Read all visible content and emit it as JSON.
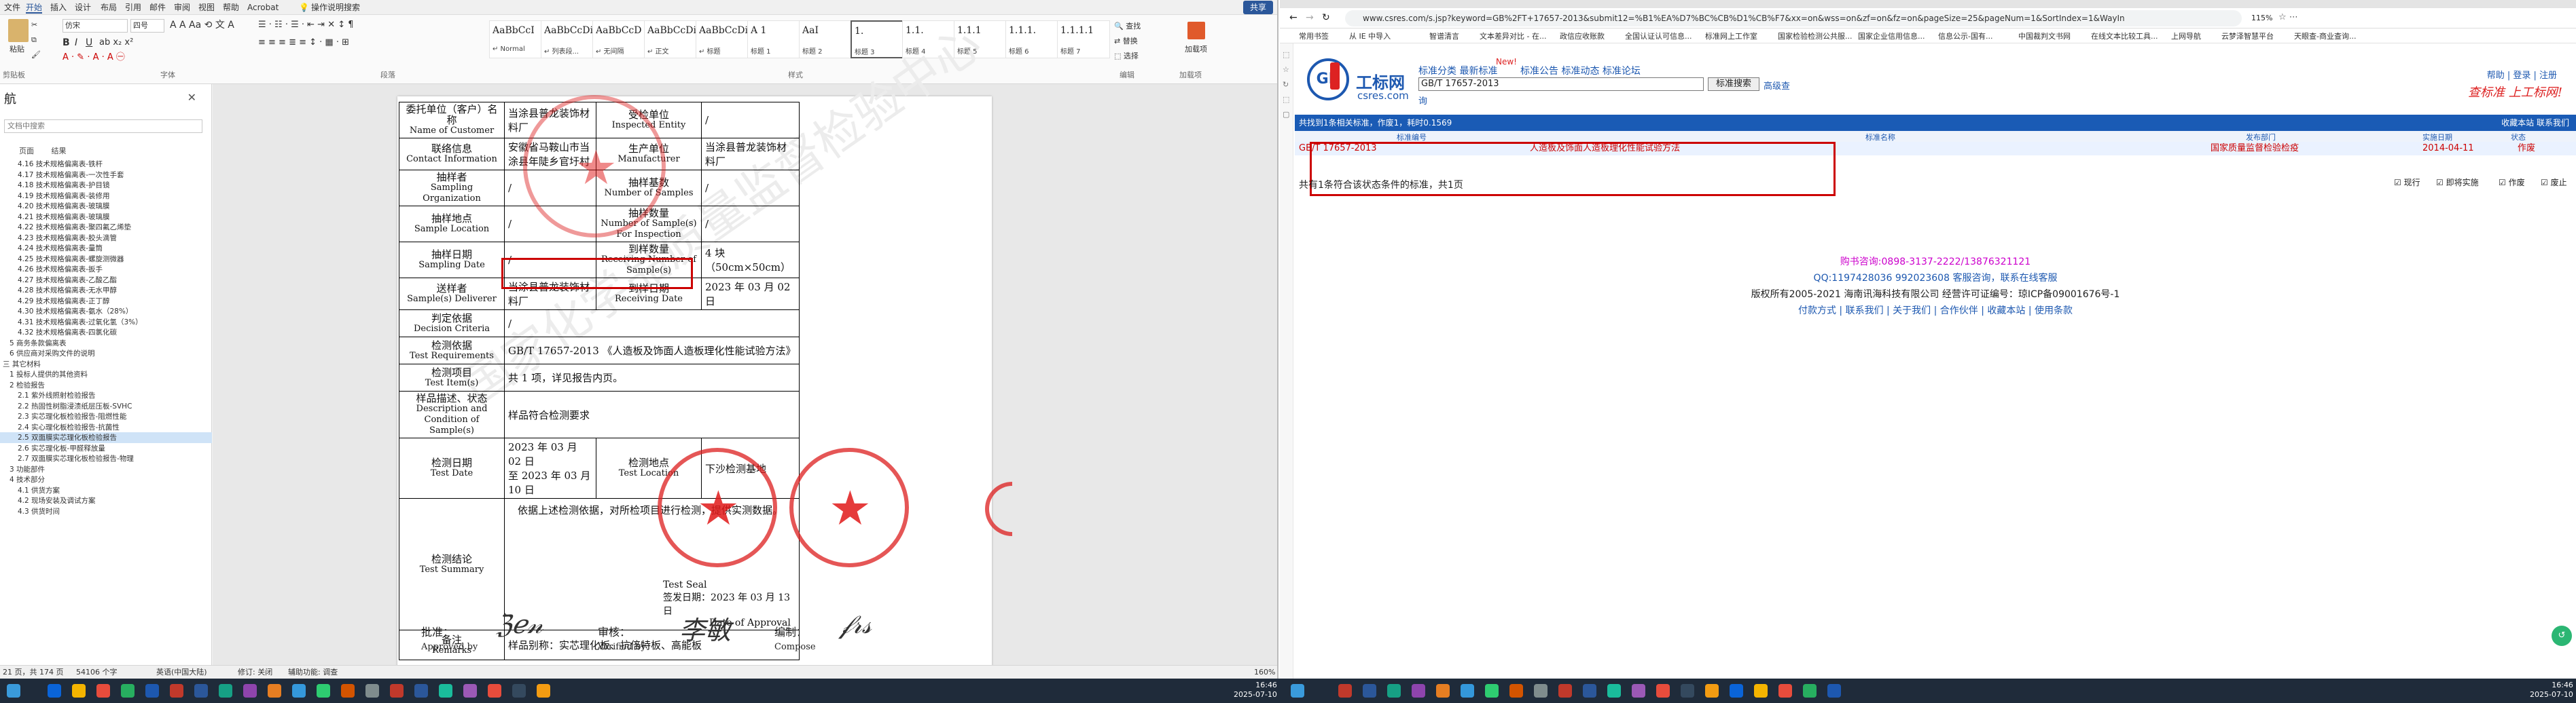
{
  "word": {
    "tabs": [
      "文件",
      "开始",
      "插入",
      "设计",
      "布局",
      "引用",
      "邮件",
      "审阅",
      "视图",
      "帮助",
      "Acrobat",
      "操作说明搜索"
    ],
    "active_tab": "开始",
    "share": "共享",
    "font_name": "仿宋",
    "font_size": "四号",
    "group_labels": [
      "剪贴板",
      "字体",
      "段落",
      "样式",
      "编辑",
      "加载项"
    ],
    "paste_label": "粘贴",
    "styles": [
      {
        "preview": "AaBbCcI",
        "name": "↵ Normal"
      },
      {
        "preview": "AaBbCcDi",
        "name": "↵ 列表段..."
      },
      {
        "preview": "AaBbCcD",
        "name": "↵ 无间隔"
      },
      {
        "preview": "AaBbCcDi",
        "name": "↵ 正文"
      },
      {
        "preview": "AaBbCcDi",
        "name": "↵ 标题"
      },
      {
        "preview": "A 1",
        "name": "标题 1"
      },
      {
        "preview": "AaI",
        "name": "标题 2"
      },
      {
        "preview": "1.",
        "name": "标题 3"
      },
      {
        "preview": "1.1.",
        "name": "标题 4"
      },
      {
        "preview": "1.1.1",
        "name": "标题 5"
      },
      {
        "preview": "1.1.1.",
        "name": "标题 6"
      },
      {
        "preview": "1.1.1.1",
        "name": "标题 7"
      }
    ],
    "edit": {
      "find": "查找",
      "replace": "替换",
      "select": "选择"
    },
    "addin": "加载项",
    "nav": {
      "title": "航",
      "search_placeholder": "文档中搜索",
      "tabs": [
        "页面",
        "结果"
      ],
      "items": [
        {
          "t": "4.16 技术规格偏离表-铁杆",
          "sel": false
        },
        {
          "t": "4.17 技术规格偏离表-一次性手套",
          "sel": false
        },
        {
          "t": "4.18 技术规格偏离表-护目镜",
          "sel": false
        },
        {
          "t": "4.19 技术规格偏离表-装修用",
          "sel": false
        },
        {
          "t": "4.20 技术规格偏离表-玻璃膜",
          "sel": false
        },
        {
          "t": "4.21 技术规格偏离表-玻璃膜",
          "sel": false
        },
        {
          "t": "4.22 技术规格偏离表-聚四氟乙烯垫",
          "sel": false
        },
        {
          "t": "4.23 技术规格偏离表-胶头滴管",
          "sel": false
        },
        {
          "t": "4.24 技术规格偏离表-量筒",
          "sel": false
        },
        {
          "t": "4.25 技术规格偏离表-螺旋测微器",
          "sel": false
        },
        {
          "t": "4.26 技术规格偏离表-扳手",
          "sel": false
        },
        {
          "t": "4.27 技术规格偏离表-乙酸乙酯",
          "sel": false
        },
        {
          "t": "4.28 技术规格偏离表-无水甲醇",
          "sel": false
        },
        {
          "t": "4.29 技术规格偏离表-正丁醇",
          "sel": false
        },
        {
          "t": "4.30 技术规格偏离表-氨水（28%）",
          "sel": false
        },
        {
          "t": "4.31 技术规格偏离表-过氧化氢（3%）",
          "sel": false
        },
        {
          "t": "4.32 技术规格偏离表-四氯化碳",
          "sel": false
        },
        {
          "t": "5 商务条款偏离表",
          "sel": false
        },
        {
          "t": "6 供应商对采购文件的说明",
          "sel": false
        },
        {
          "t": "三 其它材料",
          "sel": false
        },
        {
          "t": "1 投标人提供的其他资料",
          "sel": false
        },
        {
          "t": "2 检验报告",
          "sel": false
        },
        {
          "t": "2.1 紫外线照射检验报告",
          "sel": false
        },
        {
          "t": "2.2 热固性树脂浸渍纸层压板-SVHC",
          "sel": false
        },
        {
          "t": "2.3 实芯理化板检验报告-阻燃性能",
          "sel": false
        },
        {
          "t": "2.4 实心理化板检验报告-抗菌性",
          "sel": false
        },
        {
          "t": "2.5 双面膜实芯理化板检验报告",
          "sel": true
        },
        {
          "t": "2.6 实芯理化板-甲醛释放量",
          "sel": false
        },
        {
          "t": "2.7 双面膜实芯理化板检验报告-物理",
          "sel": false
        },
        {
          "t": "3 功能部件",
          "sel": false
        },
        {
          "t": "4 技术部分",
          "sel": false
        },
        {
          "t": "4.1 供货方案",
          "sel": false
        },
        {
          "t": "4.2 现场安装及调试方案",
          "sel": false
        },
        {
          "t": "4.3 供货时间",
          "sel": false
        }
      ]
    },
    "report": {
      "rows": [
        {
          "l": "委托单位（客户）名称",
          "le": "Name of Customer",
          "v": "当涂县普龙装饰材料厂",
          "l2": "受检单位",
          "l2e": "Inspected Entity",
          "v2": "/"
        },
        {
          "l": "联络信息",
          "le": "Contact Information",
          "v": "安徽省马鞍山市当涂县年陡乡官圩村",
          "l2": "生产单位",
          "l2e": "Manufacturer",
          "v2": "当涂县普龙装饰材料厂"
        },
        {
          "l": "抽样者",
          "le": "Sampling Organization",
          "v": "/",
          "l2": "抽样基数",
          "l2e": "Number of Samples",
          "v2": "/"
        },
        {
          "l": "抽样地点",
          "le": "Sample Location",
          "v": "/",
          "l2": "抽样数量",
          "l2e": "Number of Sample(s) For Inspection",
          "v2": "/"
        },
        {
          "l": "抽样日期",
          "le": "Sampling Date",
          "v": "/",
          "l2": "到样数量",
          "l2e": "Receiving Number of Sample(s)",
          "v2": "4 块（50cm×50cm）"
        },
        {
          "l": "送样者",
          "le": "Sample(s) Deliverer",
          "v": "当涂县普龙装饰材料厂",
          "l2": "到样日期",
          "l2e": "Receiving Date",
          "v2": "2023 年 03 月 02 日"
        }
      ],
      "decision_label": "判定依据",
      "decision_en": "Decision Criteria",
      "decision_val": "/",
      "req_label": "检测依据",
      "req_en": "Test Requirements",
      "req_val": "GB/T 17657-2013 《人造板及饰面人造板理化性能试验方法》",
      "items_label": "检测项目",
      "items_en": "Test Item(s)",
      "items_val": "共 1 项，详见报告内页。",
      "desc_label": "样品描述、状态",
      "desc_en1": "Description and",
      "desc_en2": "Condition of Sample(s)",
      "desc_val": "样品符合检测要求",
      "date_label": "检测日期",
      "date_en": "Test Date",
      "date_val1": "2023 年 03 月 02 日",
      "date_val2": "至   2023 年 03 月 10 日",
      "loc_label": "检测地点",
      "loc_en": "Test Location",
      "loc_val": "下沙检测基地",
      "summary_label": "检测结论",
      "summary_en": "Test Summary",
      "summary_val": "依据上述检测依据，对所检项目进行检测，提供实测数据。",
      "seal": "Test Seal",
      "approval_label": "签发日期：",
      "approval_val": "2023 年 03 月 13 日",
      "approval_en": "Date of Approval",
      "remarks_label": "备注",
      "remarks_en": "Remarks",
      "remarks_val": "样品别称：实芯理化板、抗倍特板、高能板",
      "sign": [
        {
          "cn": "批准：",
          "en": "Approved by"
        },
        {
          "cn": "审核：",
          "en": "Verified by"
        },
        {
          "cn": "编制：",
          "en": "Compose"
        }
      ],
      "watermark": "国家化学品质量监督检验中心"
    },
    "status": {
      "page": "21 页，共 174 页",
      "words": "54106 个字",
      "lang": "英语(中国大陆)",
      "track": "修订: 关闭",
      "access": "辅助功能: 调查",
      "zoom": "160%"
    }
  },
  "browser": {
    "url": "www.csres.com/s.jsp?keyword=GB%2FT+17657-2013&submit12=%B1%EA%D7%BC%CB%D1%CB%F7&xx=on&wss=on&zf=on&fz=on&pageSize=25&pageNum=1&SortIndex=1&WayIn",
    "zoom": "115%",
    "bookmarks": [
      "常用书签",
      "从 IE 中导入",
      "智谱清言",
      "文本差异对比 - 在...",
      "政信应收账款",
      "全国认证认可信息...",
      "标准网上工作室",
      "国家检验检测公共服...",
      "国家企业信用信息...",
      "信息公示-国有...",
      "中国裁判文书网",
      "在线文本比较工具...",
      "上网导航",
      "云梦泽智慧平台",
      "天眼查-商业查询..."
    ],
    "site": {
      "logo_cn": "工标网",
      "logo_en": "csres.com",
      "nav": "标准分类  最新标准",
      "new": "New!",
      "nav2": "标准公告  标准动态  标准论坛",
      "search_value": "GB/T 17657-2013",
      "search_btn": "标准搜索",
      "adv": "高级查",
      "adv2": "询",
      "account": "帮助 | 登录 | 注册",
      "slogan": "查标准 上工标网!",
      "found": "共找到1条相关标准，作废1，耗时0.1569",
      "right_links": "收藏本站  联系我们",
      "cols": [
        "标准编号",
        "标准名称",
        "发布部门",
        "实施日期",
        "状态"
      ],
      "result": {
        "no": "GB/T 17657-2013",
        "name": "人造板及饰面人造板理化性能试验方法",
        "dept": "国家质量监督检验检疫",
        "date": "2014-04-11",
        "status": "作废"
      },
      "count": "共有1条符合该状态条件的标准，共1页",
      "checks": [
        "现行",
        "即将实施",
        "作废",
        "废止"
      ],
      "footer": [
        {
          "t": "购书咨询:0898-3137-2222/13876321121",
          "c": "#c0c"
        },
        {
          "t": "QQ:1197428036 992023608  客服咨询，联系在线客服",
          "c": "#1d58b0"
        },
        {
          "t": "版权所有2005-2021 海南讯海科技有限公司 经营许可证编号：琼ICP备09001676号-1",
          "c": "#222"
        },
        {
          "t": "付款方式 | 联系我们 | 关于我们 | 合作伙伴 | 收藏本站 | 使用条款",
          "c": "#1d58b0"
        }
      ]
    }
  },
  "taskbar": {
    "time1": "16:46",
    "date1": "2025-07-10",
    "time2": "16:46",
    "date2": "2025-07-10"
  }
}
